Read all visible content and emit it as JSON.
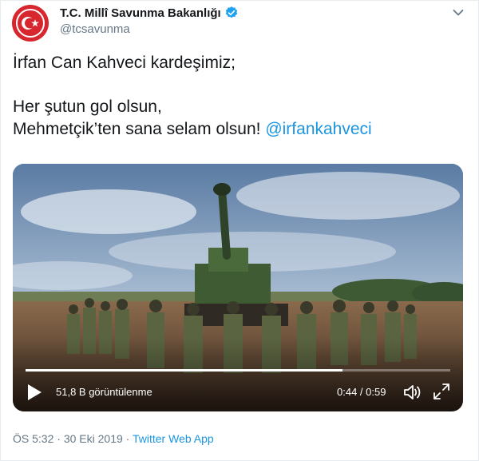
{
  "account": {
    "name": "T.C. Millî Savunma Bakanlığı",
    "handle": "@tcsavunma",
    "avatar_icon": "ministry-crest-icon",
    "verified_icon": "verified-badge-icon",
    "brand_color": "#d7262d"
  },
  "tweet": {
    "line1": "İrfan Can Kahveci kardeşimiz;",
    "line2": "Her şutun gol olsun,",
    "line3_text": "Mehmetçik’ten sana selam olsun!",
    "mention": "@irfankahveci",
    "mention_color": "#1b95e0"
  },
  "video": {
    "views": "51,8 B görüntülenme",
    "time": "0:44 / 0:59",
    "progress": 0.7458,
    "play_icon": "play-icon",
    "volume_icon": "volume-icon",
    "fullscreen_icon": "fullscreen-icon"
  },
  "meta": {
    "time": "ÖS 5:32",
    "separator": " · ",
    "date": "30 Eki 2019",
    "source": "Twitter Web App"
  },
  "menu_icon": "chevron-down-icon"
}
